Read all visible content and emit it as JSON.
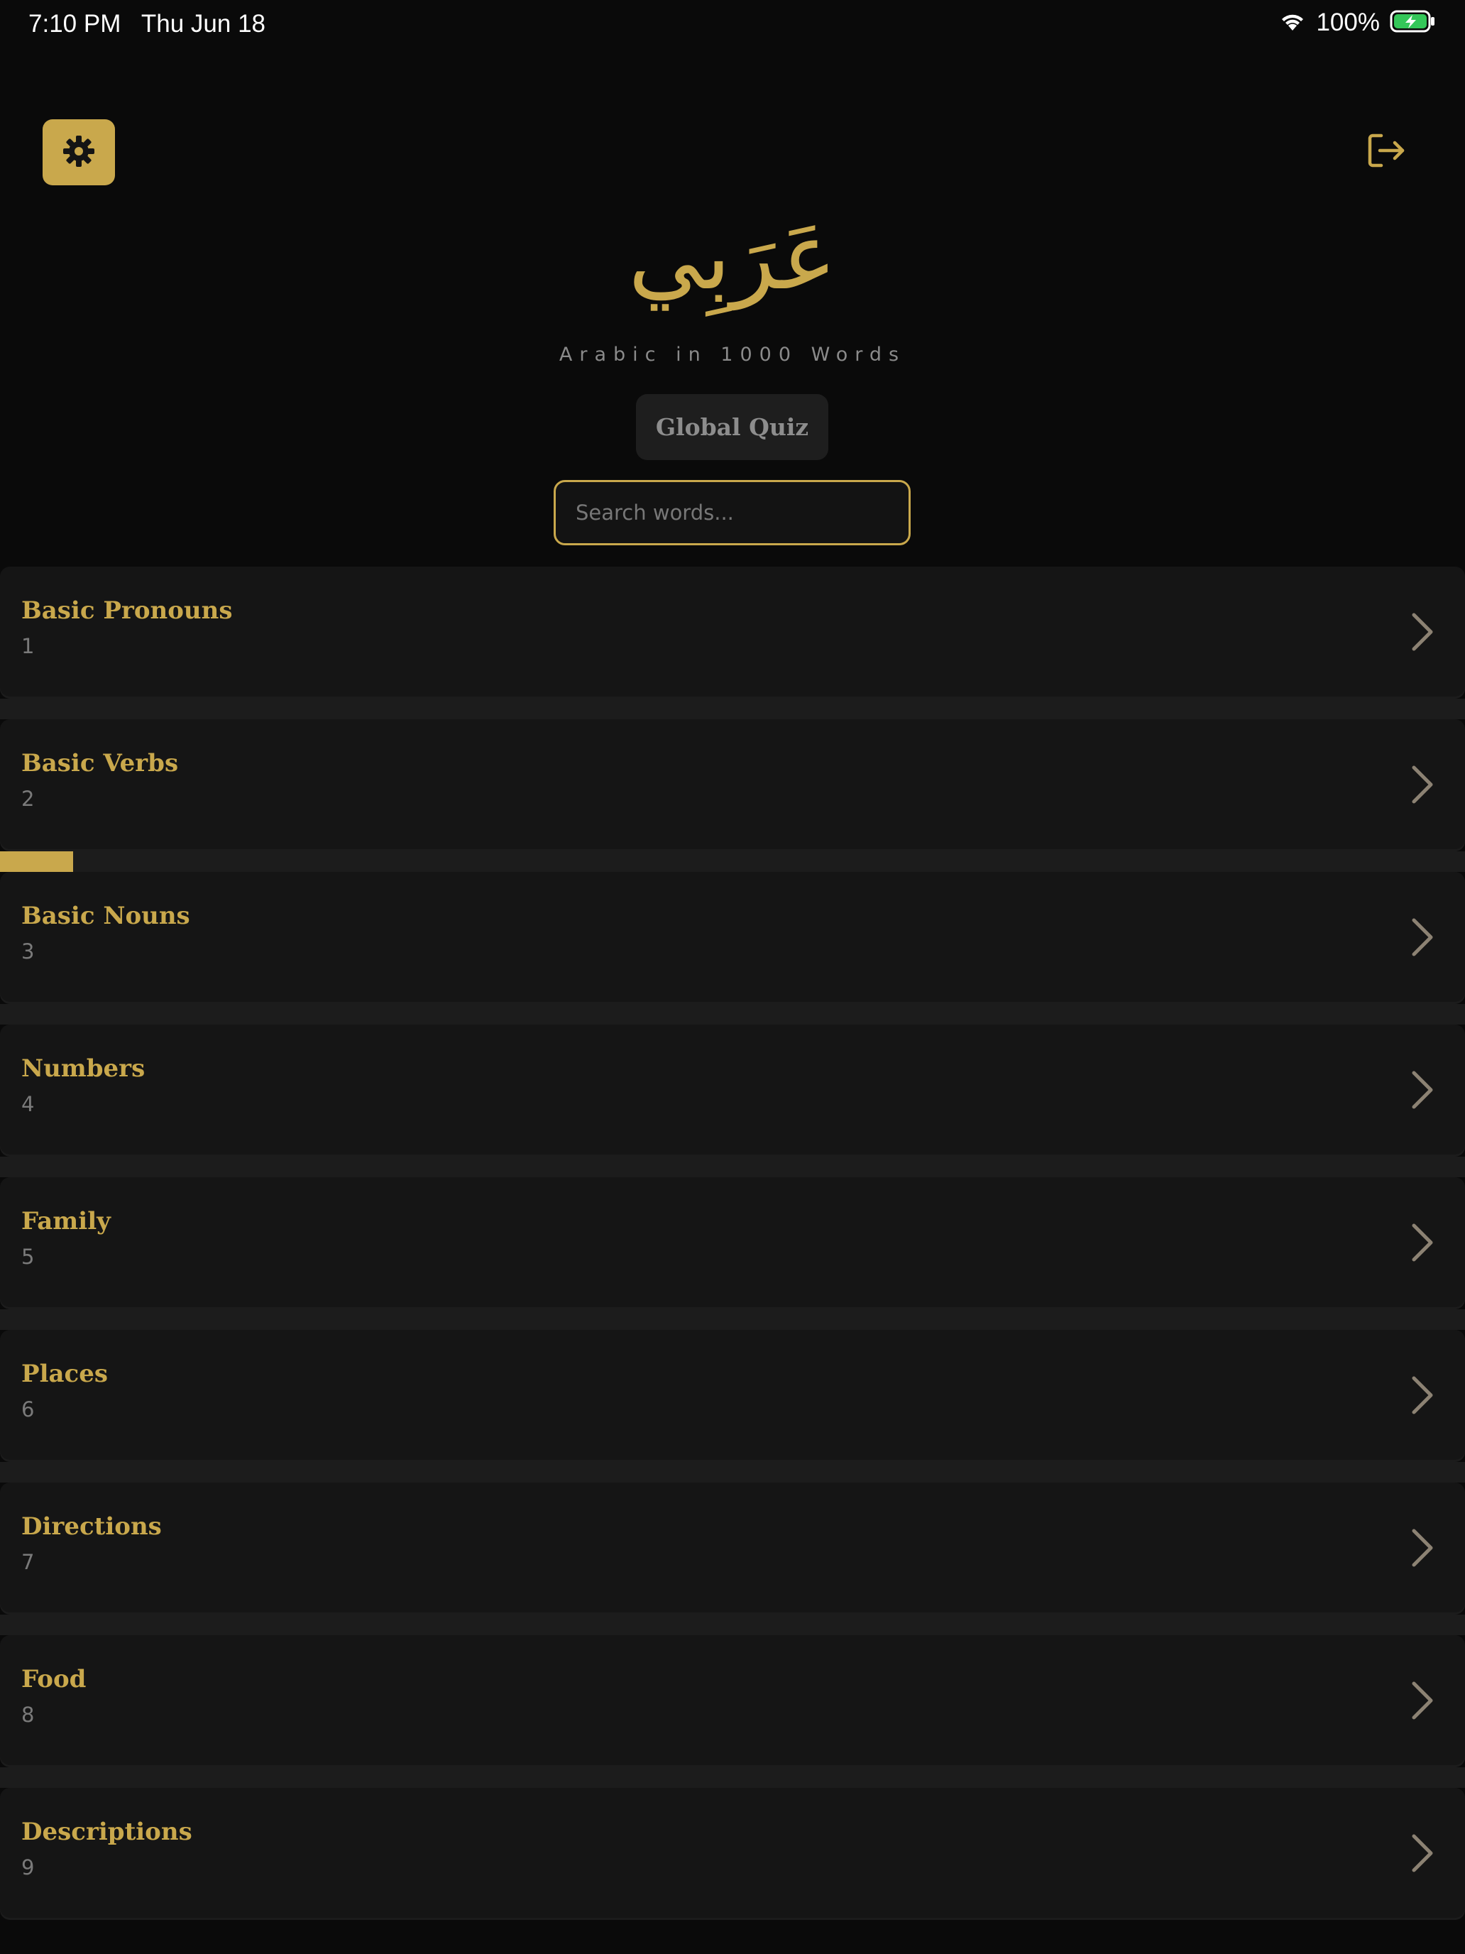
{
  "status_bar": {
    "time": "7:10 PM   Thu Jun 18",
    "battery_percent": "100%",
    "icons": [
      "wifi-icon",
      "battery-charging-icon"
    ]
  },
  "header": {
    "settings_icon": "gear-icon",
    "logout_icon": "logout-icon"
  },
  "logo": {
    "title": "عَرَبِي",
    "tagline": "Arabic in 1000 Words"
  },
  "quiz": {
    "label": "Global Quiz"
  },
  "search": {
    "placeholder": "Search words..."
  },
  "categories": [
    {
      "name": "Basic Pronouns",
      "number": "1",
      "progress": 0
    },
    {
      "name": "Basic Verbs",
      "number": "2",
      "progress": 0.05
    },
    {
      "name": "Basic Nouns",
      "number": "3",
      "progress": 0
    },
    {
      "name": "Numbers",
      "number": "4",
      "progress": 0
    },
    {
      "name": "Family",
      "number": "5",
      "progress": 0
    },
    {
      "name": "Places",
      "number": "6",
      "progress": 0
    },
    {
      "name": "Directions",
      "number": "7",
      "progress": 0
    },
    {
      "name": "Food",
      "number": "8",
      "progress": 0
    },
    {
      "name": "Descriptions",
      "number": "9",
      "progress": 0
    }
  ],
  "colors": {
    "accent": "#c9a84c",
    "background": "#0a0a0a",
    "card": "#151515",
    "muted": "#7a7a7a"
  }
}
